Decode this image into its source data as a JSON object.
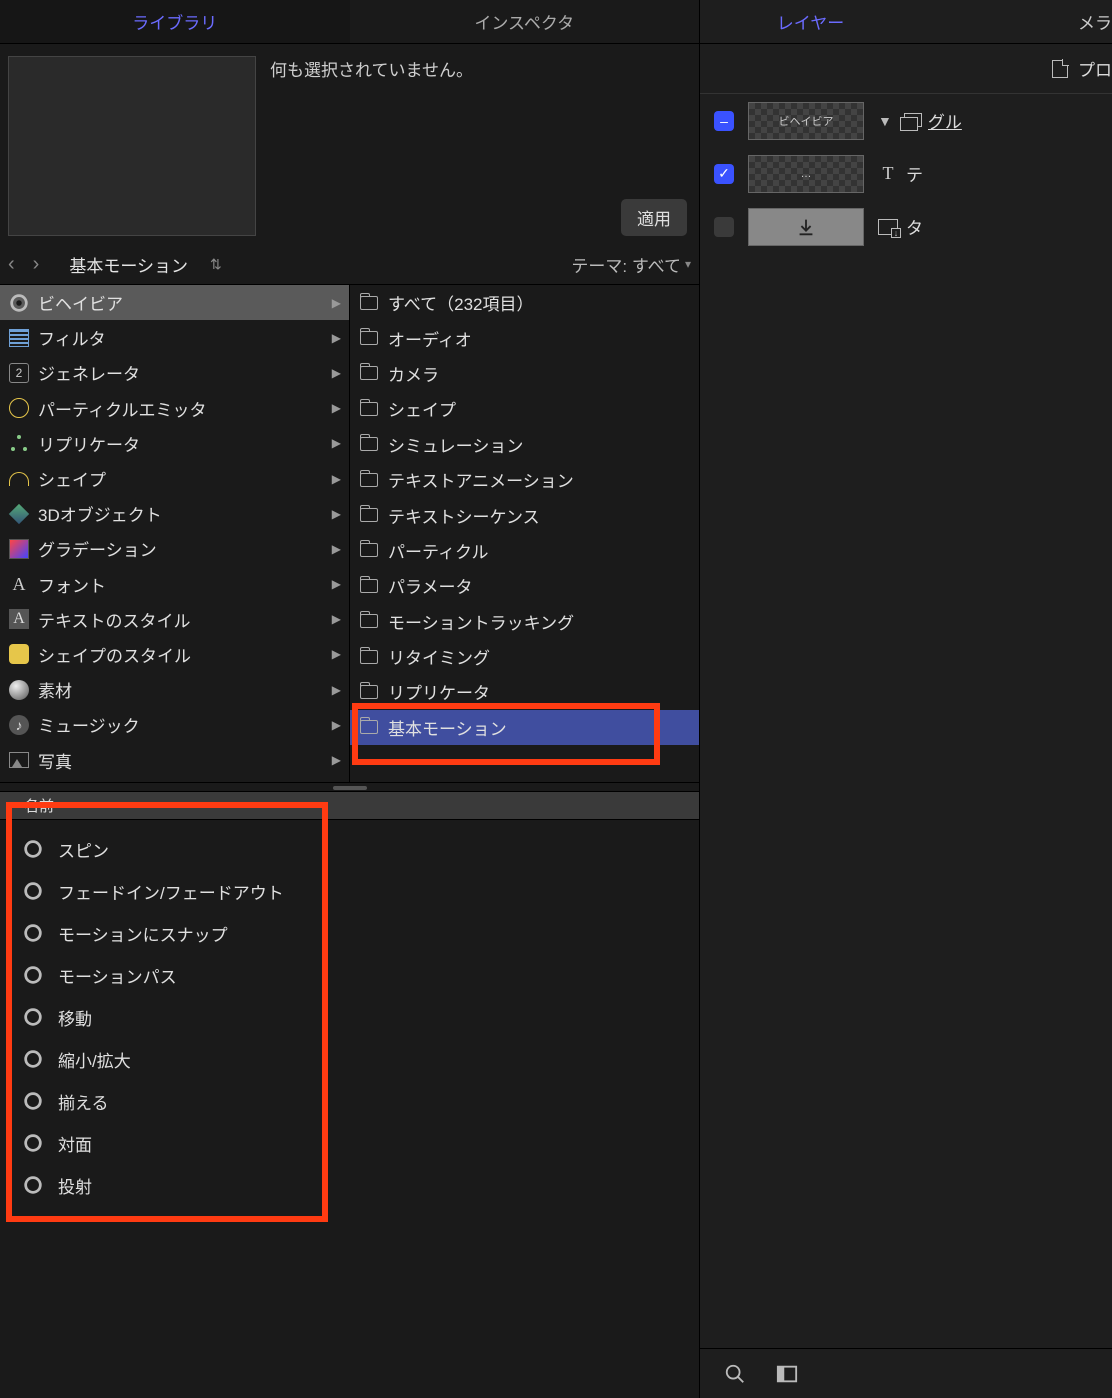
{
  "tabs": {
    "library": "ライブラリ",
    "inspector": "インスペクタ"
  },
  "preview": {
    "no_selection": "何も選択されていません。",
    "apply": "適用"
  },
  "pathbar": {
    "title": "基本モーション",
    "theme_label": "テーマ: すべて"
  },
  "categories": [
    {
      "label": "ビヘイビア",
      "icon": "gear",
      "sel": true
    },
    {
      "label": "フィルタ",
      "icon": "film"
    },
    {
      "label": "ジェネレータ",
      "icon": "gen"
    },
    {
      "label": "パーティクルエミッタ",
      "icon": "emit"
    },
    {
      "label": "リプリケータ",
      "icon": "rep"
    },
    {
      "label": "シェイプ",
      "icon": "shape"
    },
    {
      "label": "3Dオブジェクト",
      "icon": "cube"
    },
    {
      "label": "グラデーション",
      "icon": "grad"
    },
    {
      "label": "フォント",
      "icon": "fontA"
    },
    {
      "label": "テキストのスタイル",
      "icon": "fontA2"
    },
    {
      "label": "シェイプのスタイル",
      "icon": "sstyle"
    },
    {
      "label": "素材",
      "icon": "mat"
    },
    {
      "label": "ミュージック",
      "icon": "music"
    },
    {
      "label": "写真",
      "icon": "photo"
    }
  ],
  "subcats": [
    {
      "label": "すべて（232項目）"
    },
    {
      "label": "オーディオ"
    },
    {
      "label": "カメラ"
    },
    {
      "label": "シェイプ"
    },
    {
      "label": "シミュレーション"
    },
    {
      "label": "テキストアニメーション"
    },
    {
      "label": "テキストシーケンス"
    },
    {
      "label": "パーティクル"
    },
    {
      "label": "パラメータ"
    },
    {
      "label": "モーショントラッキング"
    },
    {
      "label": "リタイミング"
    },
    {
      "label": "リプリケータ"
    },
    {
      "label": "基本モーション",
      "sel": true
    }
  ],
  "list_header": "名前",
  "items": [
    "スピン",
    "フェードイン/フェードアウト",
    "モーションにスナップ",
    "モーションパス",
    "移動",
    "縮小/拡大",
    "揃える",
    "対面",
    "投射"
  ],
  "right": {
    "tabs": {
      "layers": "レイヤー",
      "meta": "メラ"
    },
    "project_label": "プロ",
    "layers": [
      {
        "chk": "dash",
        "thumb_text": "ビヘイビア",
        "thumb": "pat",
        "type": "group",
        "label": "グル"
      },
      {
        "chk": "on",
        "thumb_text": "…",
        "thumb": "pat",
        "type": "text",
        "label": "テ"
      },
      {
        "chk": "off",
        "thumb_text": "",
        "thumb": "dl",
        "type": "dl",
        "label": "タ"
      }
    ]
  }
}
